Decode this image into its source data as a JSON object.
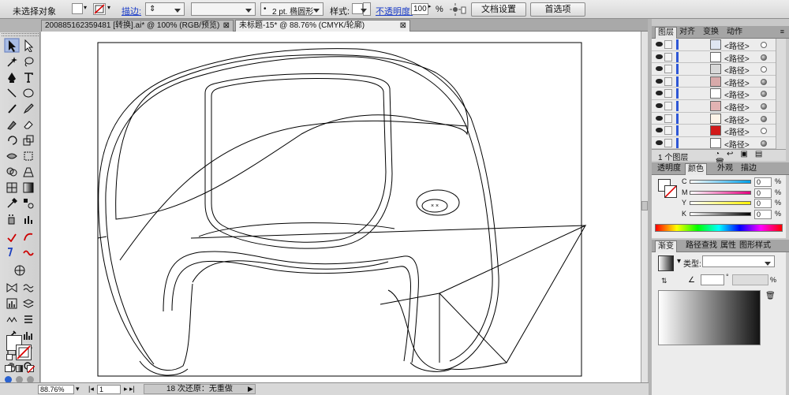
{
  "control": {
    "selection": "未选择对象",
    "stroke_link": "描边:",
    "brush": "2 pt. 椭圆形",
    "style_label": "样式:",
    "opacity_link": "不透明度:",
    "opacity_value": "100",
    "opacity_unit": "%",
    "doc_settings": "文档设置",
    "preferences": "首选项"
  },
  "tabs": [
    {
      "label": "200885162359481 [转换].ai* @ 100% (RGB/预览)",
      "close": "⊠"
    },
    {
      "label": "未标题-15* @ 88.76% (CMYK/轮廓)",
      "close": "⊠"
    }
  ],
  "status": {
    "zoom": "88.76%",
    "page": "1",
    "undo": "18 次还原：无重做"
  },
  "layers_panel": {
    "tabs": [
      "图层",
      "对齐",
      "变换",
      "动作"
    ],
    "rows": [
      {
        "name": "<路径>",
        "thumb": "#dfe6f2",
        "target": "empty"
      },
      {
        "name": "<路径>",
        "thumb": "#ffffff",
        "target": "filled"
      },
      {
        "name": "<路径>",
        "thumb": "#d8d8d8",
        "target": "empty"
      },
      {
        "name": "<路径>",
        "thumb": "#d8aaaa",
        "target": "filled"
      },
      {
        "name": "<路径>",
        "thumb": "#ffffff",
        "target": "filled"
      },
      {
        "name": "<路径>",
        "thumb": "#e2b3b3",
        "target": "filled"
      },
      {
        "name": "<路径>",
        "thumb": "#fdf3e8",
        "target": "filled"
      },
      {
        "name": "<路径>",
        "thumb": "#d21a1a",
        "target": "empty"
      },
      {
        "name": "<路径>",
        "thumb": "#ffffff",
        "target": "filled"
      }
    ],
    "footer": "1 个图层"
  },
  "color_panel": {
    "tabs": [
      "透明度",
      "颜色",
      "外观",
      "描边"
    ],
    "channels": [
      {
        "label": "C",
        "value": "0",
        "unit": "%",
        "gradient": "linear-gradient(90deg,#fff,#00a0e9)"
      },
      {
        "label": "M",
        "value": "0",
        "unit": "%",
        "gradient": "linear-gradient(90deg,#fff,#e4007f)"
      },
      {
        "label": "Y",
        "value": "0",
        "unit": "%",
        "gradient": "linear-gradient(90deg,#fff,#fff100)"
      },
      {
        "label": "K",
        "value": "0",
        "unit": "%",
        "gradient": "linear-gradient(90deg,#fff,#000)"
      }
    ]
  },
  "gradient_panel": {
    "tabs": [
      "渐变",
      "路径查找",
      "属性",
      "图形样式"
    ],
    "type_label": "类型:",
    "degree": "°",
    "percent": "%"
  }
}
